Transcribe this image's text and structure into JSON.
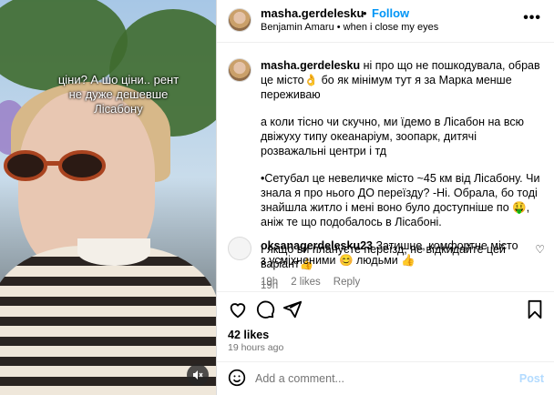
{
  "media": {
    "caption_line1": "ціни? А шо ціни.. рент",
    "caption_line2": "не дуже дешевше",
    "caption_line3": "Лісабону",
    "mute_icon": "speaker-muted-icon"
  },
  "header": {
    "username": "masha.gerdelesku",
    "separator": "•",
    "follow_label": "Follow",
    "subtitle": "Benjamin Amaru • when i close my eyes",
    "more_label": "•••"
  },
  "caption": {
    "username": "masha.gerdelesku",
    "para1": " ні про що не пошкодувала, обрав це місто👌 бо як мінімум тут я за Марка менше переживаю",
    "para2": "а коли тісно чи скучно, ми їдемо в Лісабон на всю двіжуху типу океанаріум, зоопарк, дитячі розважальні центри і тд",
    "para3": "•Сетубал це невеличке місто ~45 км від Лісабону. Чи знала я про нього ДО переїзду? -Ні. Обрала, бо тоді знайшла житло і мені воно було доступніше по 🤑, аніж те що подобалось в Лісабоні.",
    "para4": "І якщо ви плануєте переїзд, не відкидайте цей варіант👍",
    "time": "19h"
  },
  "comment": {
    "username": "oksanagerdelesku23",
    "text": " Затишне, комфортне місто з усміхненими 😊 людьми 👍",
    "time": "19h",
    "likes": "2 likes",
    "reply": "Reply"
  },
  "actions": {
    "like_icon": "heart-icon",
    "comment_icon": "comment-icon",
    "share_icon": "share-icon",
    "save_icon": "bookmark-icon",
    "likes_count": "42 likes",
    "posted": "19 hours ago"
  },
  "add_comment": {
    "placeholder": "Add a comment...",
    "post_label": "Post"
  },
  "colors": {
    "link_blue": "#0095f6",
    "post_disabled": "#b3dbff",
    "muted_text": "#737373"
  }
}
